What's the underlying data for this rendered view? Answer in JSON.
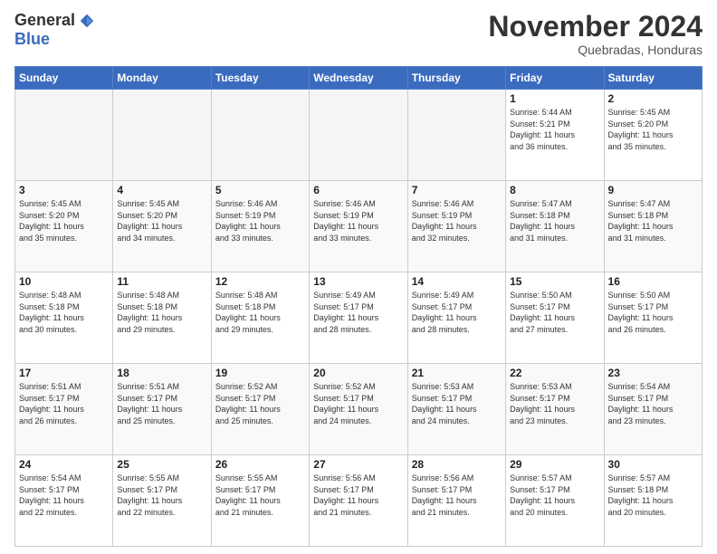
{
  "header": {
    "logo_general": "General",
    "logo_blue": "Blue",
    "month_title": "November 2024",
    "location": "Quebradas, Honduras"
  },
  "weekdays": [
    "Sunday",
    "Monday",
    "Tuesday",
    "Wednesday",
    "Thursday",
    "Friday",
    "Saturday"
  ],
  "weeks": [
    [
      {
        "day": "",
        "info": ""
      },
      {
        "day": "",
        "info": ""
      },
      {
        "day": "",
        "info": ""
      },
      {
        "day": "",
        "info": ""
      },
      {
        "day": "",
        "info": ""
      },
      {
        "day": "1",
        "info": "Sunrise: 5:44 AM\nSunset: 5:21 PM\nDaylight: 11 hours\nand 36 minutes."
      },
      {
        "day": "2",
        "info": "Sunrise: 5:45 AM\nSunset: 5:20 PM\nDaylight: 11 hours\nand 35 minutes."
      }
    ],
    [
      {
        "day": "3",
        "info": "Sunrise: 5:45 AM\nSunset: 5:20 PM\nDaylight: 11 hours\nand 35 minutes."
      },
      {
        "day": "4",
        "info": "Sunrise: 5:45 AM\nSunset: 5:20 PM\nDaylight: 11 hours\nand 34 minutes."
      },
      {
        "day": "5",
        "info": "Sunrise: 5:46 AM\nSunset: 5:19 PM\nDaylight: 11 hours\nand 33 minutes."
      },
      {
        "day": "6",
        "info": "Sunrise: 5:46 AM\nSunset: 5:19 PM\nDaylight: 11 hours\nand 33 minutes."
      },
      {
        "day": "7",
        "info": "Sunrise: 5:46 AM\nSunset: 5:19 PM\nDaylight: 11 hours\nand 32 minutes."
      },
      {
        "day": "8",
        "info": "Sunrise: 5:47 AM\nSunset: 5:18 PM\nDaylight: 11 hours\nand 31 minutes."
      },
      {
        "day": "9",
        "info": "Sunrise: 5:47 AM\nSunset: 5:18 PM\nDaylight: 11 hours\nand 31 minutes."
      }
    ],
    [
      {
        "day": "10",
        "info": "Sunrise: 5:48 AM\nSunset: 5:18 PM\nDaylight: 11 hours\nand 30 minutes."
      },
      {
        "day": "11",
        "info": "Sunrise: 5:48 AM\nSunset: 5:18 PM\nDaylight: 11 hours\nand 29 minutes."
      },
      {
        "day": "12",
        "info": "Sunrise: 5:48 AM\nSunset: 5:18 PM\nDaylight: 11 hours\nand 29 minutes."
      },
      {
        "day": "13",
        "info": "Sunrise: 5:49 AM\nSunset: 5:17 PM\nDaylight: 11 hours\nand 28 minutes."
      },
      {
        "day": "14",
        "info": "Sunrise: 5:49 AM\nSunset: 5:17 PM\nDaylight: 11 hours\nand 28 minutes."
      },
      {
        "day": "15",
        "info": "Sunrise: 5:50 AM\nSunset: 5:17 PM\nDaylight: 11 hours\nand 27 minutes."
      },
      {
        "day": "16",
        "info": "Sunrise: 5:50 AM\nSunset: 5:17 PM\nDaylight: 11 hours\nand 26 minutes."
      }
    ],
    [
      {
        "day": "17",
        "info": "Sunrise: 5:51 AM\nSunset: 5:17 PM\nDaylight: 11 hours\nand 26 minutes."
      },
      {
        "day": "18",
        "info": "Sunrise: 5:51 AM\nSunset: 5:17 PM\nDaylight: 11 hours\nand 25 minutes."
      },
      {
        "day": "19",
        "info": "Sunrise: 5:52 AM\nSunset: 5:17 PM\nDaylight: 11 hours\nand 25 minutes."
      },
      {
        "day": "20",
        "info": "Sunrise: 5:52 AM\nSunset: 5:17 PM\nDaylight: 11 hours\nand 24 minutes."
      },
      {
        "day": "21",
        "info": "Sunrise: 5:53 AM\nSunset: 5:17 PM\nDaylight: 11 hours\nand 24 minutes."
      },
      {
        "day": "22",
        "info": "Sunrise: 5:53 AM\nSunset: 5:17 PM\nDaylight: 11 hours\nand 23 minutes."
      },
      {
        "day": "23",
        "info": "Sunrise: 5:54 AM\nSunset: 5:17 PM\nDaylight: 11 hours\nand 23 minutes."
      }
    ],
    [
      {
        "day": "24",
        "info": "Sunrise: 5:54 AM\nSunset: 5:17 PM\nDaylight: 11 hours\nand 22 minutes."
      },
      {
        "day": "25",
        "info": "Sunrise: 5:55 AM\nSunset: 5:17 PM\nDaylight: 11 hours\nand 22 minutes."
      },
      {
        "day": "26",
        "info": "Sunrise: 5:55 AM\nSunset: 5:17 PM\nDaylight: 11 hours\nand 21 minutes."
      },
      {
        "day": "27",
        "info": "Sunrise: 5:56 AM\nSunset: 5:17 PM\nDaylight: 11 hours\nand 21 minutes."
      },
      {
        "day": "28",
        "info": "Sunrise: 5:56 AM\nSunset: 5:17 PM\nDaylight: 11 hours\nand 21 minutes."
      },
      {
        "day": "29",
        "info": "Sunrise: 5:57 AM\nSunset: 5:17 PM\nDaylight: 11 hours\nand 20 minutes."
      },
      {
        "day": "30",
        "info": "Sunrise: 5:57 AM\nSunset: 5:18 PM\nDaylight: 11 hours\nand 20 minutes."
      }
    ]
  ]
}
